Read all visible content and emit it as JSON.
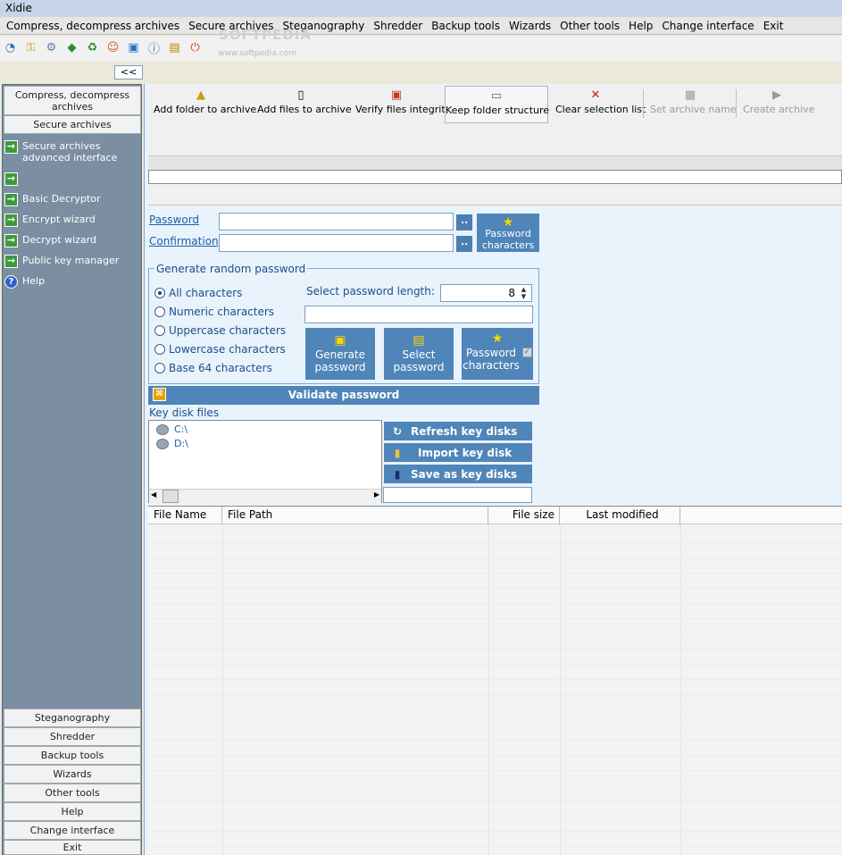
{
  "app": {
    "title": "Xidie"
  },
  "menu": [
    "Compress, decompress archives",
    "Secure archives",
    "Steganography",
    "Shredder",
    "Backup tools",
    "Wizards",
    "Other tools",
    "Help",
    "Change interface",
    "Exit"
  ],
  "watermark": {
    "big": "SOFTPEDIA",
    "small": "www.softpedia.com"
  },
  "iconbar": [
    "compress-icon",
    "key-icon",
    "gears-icon",
    "shield-icon",
    "shred-icon",
    "users-icon",
    "backup-icon",
    "help-icon",
    "folder-icon",
    "power-icon"
  ],
  "collapse": {
    "label": "<<"
  },
  "sidebar": {
    "top_buttons": [
      "Compress, decompress archives",
      "Secure archives"
    ],
    "links": [
      "Secure archives advanced interface",
      "",
      "Basic Decryptor",
      "Encrypt wizard",
      "Decrypt wizard",
      "Public key manager",
      "Help"
    ],
    "bottom_buttons": [
      "Steganography",
      "Shredder",
      "Backup tools",
      "Wizards",
      "Other tools",
      "Help",
      "Change interface",
      "Exit"
    ]
  },
  "toolbar": {
    "add_folder": "Add folder to archive",
    "add_files": "Add files to archive",
    "verify": "Verify files integrity",
    "keep_structure": "Keep folder structure",
    "clear": "Clear selection list",
    "set_name": "Set archive name",
    "create": "Create archive"
  },
  "password": {
    "password_label": "Password",
    "confirmation_label": "Confirmation",
    "password_value": "",
    "confirmation_value": "",
    "dots": "..",
    "chars_button": "Password characters"
  },
  "generator": {
    "legend": "Generate random password",
    "options": [
      "All characters",
      "Numeric characters",
      "Uppercase characters",
      "Lowercase characters",
      "Base 64 characters"
    ],
    "selected_option": "All characters",
    "length_label": "Select password length:",
    "length_value": "8",
    "generated_value": "",
    "generate_button": "Generate password",
    "select_button": "Select password",
    "chars_button": "Password characters",
    "chars_checked": true
  },
  "validate": {
    "label": "Validate password"
  },
  "keydisk": {
    "label": "Key disk files",
    "drives": [
      "C:\\",
      "D:\\"
    ],
    "refresh": "Refresh key disks",
    "import": "Import key disk",
    "save": "Save as  key disks",
    "field_value": ""
  },
  "table": {
    "columns": [
      "File Name",
      "File Path",
      "File size",
      "Last modified"
    ],
    "rows": []
  }
}
